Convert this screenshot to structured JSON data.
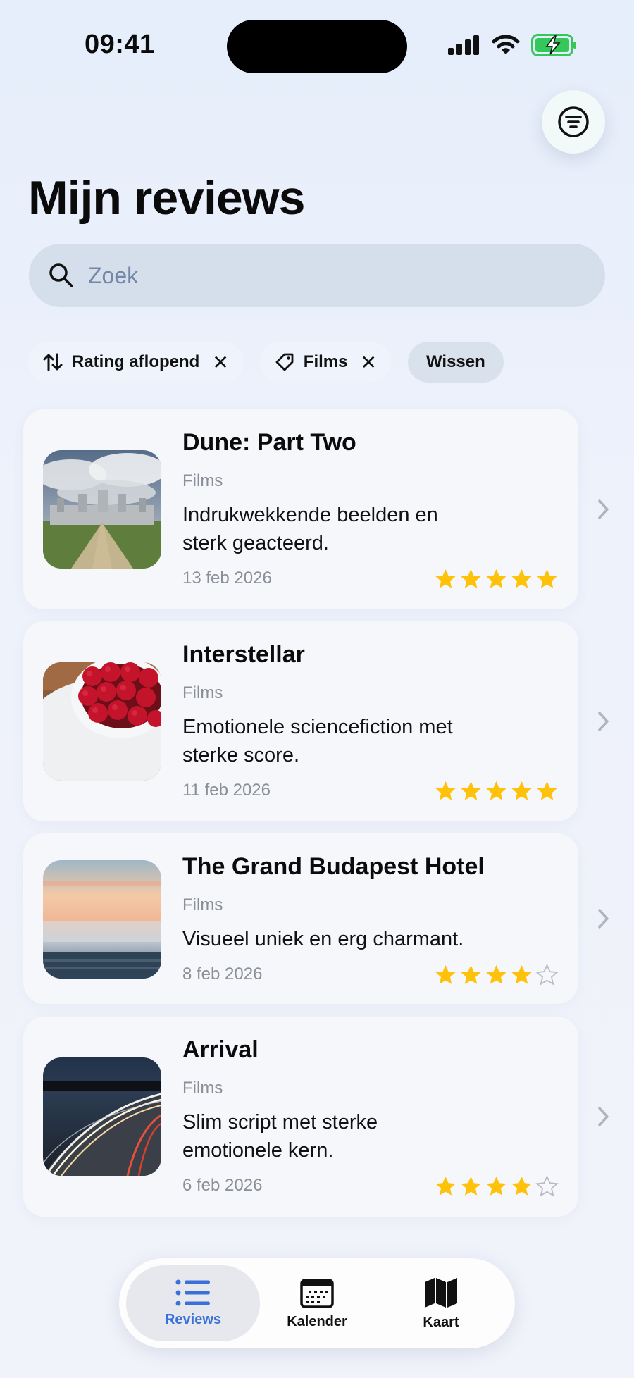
{
  "status_bar": {
    "time": "09:41"
  },
  "header": {
    "title": "Mijn reviews",
    "filter_icon": "filter-icon"
  },
  "search": {
    "placeholder": "Zoek",
    "value": ""
  },
  "chips": [
    {
      "icon": "sort-arrows-icon",
      "label": "Rating aflopend",
      "removable": true
    },
    {
      "icon": "tag-icon",
      "label": "Films",
      "removable": true
    },
    {
      "label": "Wissen",
      "removable": false
    }
  ],
  "reviews": [
    {
      "title": "Dune: Part Two",
      "category": "Films",
      "description_line1": "Indrukwekkende beelden en",
      "description_line2": "sterk geacteerd.",
      "date": "13 feb 2026",
      "rating": 5,
      "image": "castle-photo"
    },
    {
      "title": "Interstellar",
      "category": "Films",
      "description_line1": "Emotionele sciencefiction met",
      "description_line2": "sterke score.",
      "date": "11 feb 2026",
      "rating": 5,
      "image": "raspberries-photo"
    },
    {
      "title": "The Grand Budapest Hotel",
      "category": "Films",
      "description_line1": "Visueel uniek en erg charmant.",
      "description_line2": "",
      "date": "8 feb 2026",
      "rating": 4,
      "image": "foggy-sea-sunset-photo"
    },
    {
      "title": "Arrival",
      "category": "Films",
      "description_line1": "Slim script met sterke",
      "description_line2": "emotionele kern.",
      "date": "6 feb 2026",
      "rating": 4,
      "image": "highway-light-trails-photo"
    }
  ],
  "tab_bar": {
    "tabs": [
      {
        "label": "Reviews",
        "icon": "list-icon",
        "active": true
      },
      {
        "label": "Kalender",
        "icon": "calendar-icon",
        "active": false
      },
      {
        "label": "Kaart",
        "icon": "map-icon",
        "active": false
      }
    ]
  },
  "colors": {
    "accent": "#3a70d9",
    "star": "#ffc20a",
    "star_empty": "#b9bcc4",
    "battery": "#34c759"
  }
}
